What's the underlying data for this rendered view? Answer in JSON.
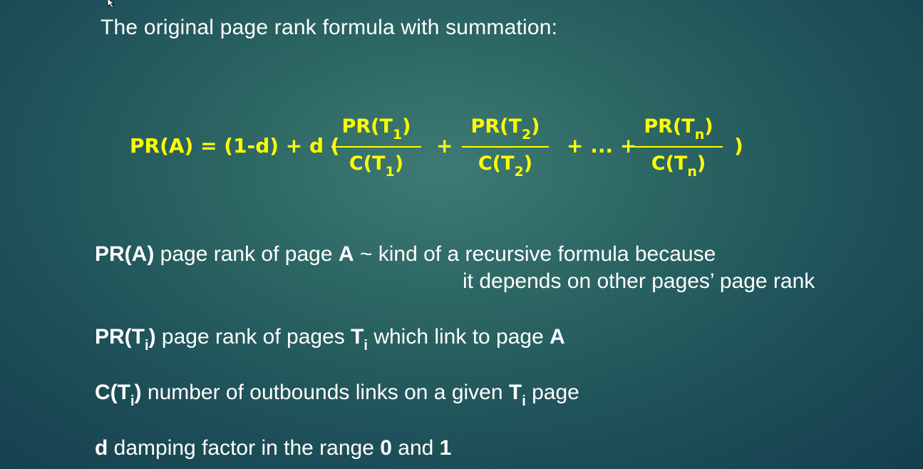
{
  "slide": {
    "title": "The original page rank formula with summation:",
    "formula": {
      "lhs": "PR(A) = (1-d) + d (",
      "frac1_num_pre": "PR(T",
      "frac1_num_sub": "1",
      "frac1_num_post": ")",
      "frac1_den_pre": "C(T",
      "frac1_den_sub": "1",
      "frac1_den_post": ")",
      "plus": "+",
      "frac2_num_pre": "PR(T",
      "frac2_num_sub": "2",
      "frac2_num_post": ")",
      "frac2_den_pre": "C(T",
      "frac2_den_sub": "2",
      "frac2_den_post": ")",
      "ellipsis": "+ ... +",
      "frac3_num_pre": "PR(T",
      "frac3_num_sub": "n",
      "frac3_num_post": ")",
      "frac3_den_pre": "C(T",
      "frac3_den_sub": "n",
      "frac3_den_post": ")",
      "close": ")"
    },
    "definitions": {
      "pra_term": "PR(A)",
      "pra_text": " page rank of page ",
      "pra_page": "A",
      "pra_note": "  ~ kind of a recursive formula because",
      "pra_note2": "it depends on other pages’ page rank",
      "prti_term_pre": "PR(T",
      "prti_term_sub": "i",
      "prti_term_post": ")",
      "prti_text": " page rank of pages ",
      "prti_pages": "T",
      "prti_pages_sub": "i",
      "prti_text2": " which link to page ",
      "prti_page": "A",
      "cti_term_pre": "C(T",
      "cti_term_sub": "i",
      "cti_term_post": ")",
      "cti_text": "  number of outbounds links on a given ",
      "cti_t": "T",
      "cti_t_sub": "i",
      "cti_text2": " page",
      "d_term": "d",
      "d_text": " damping factor in the range ",
      "d_low": "0",
      "d_and": " and ",
      "d_high": "1"
    }
  },
  "colors": {
    "formula": "#ffff00",
    "text": "#ffffff",
    "background": "#2c6663"
  },
  "icons": {
    "cursor": "mouse-cursor-icon"
  }
}
